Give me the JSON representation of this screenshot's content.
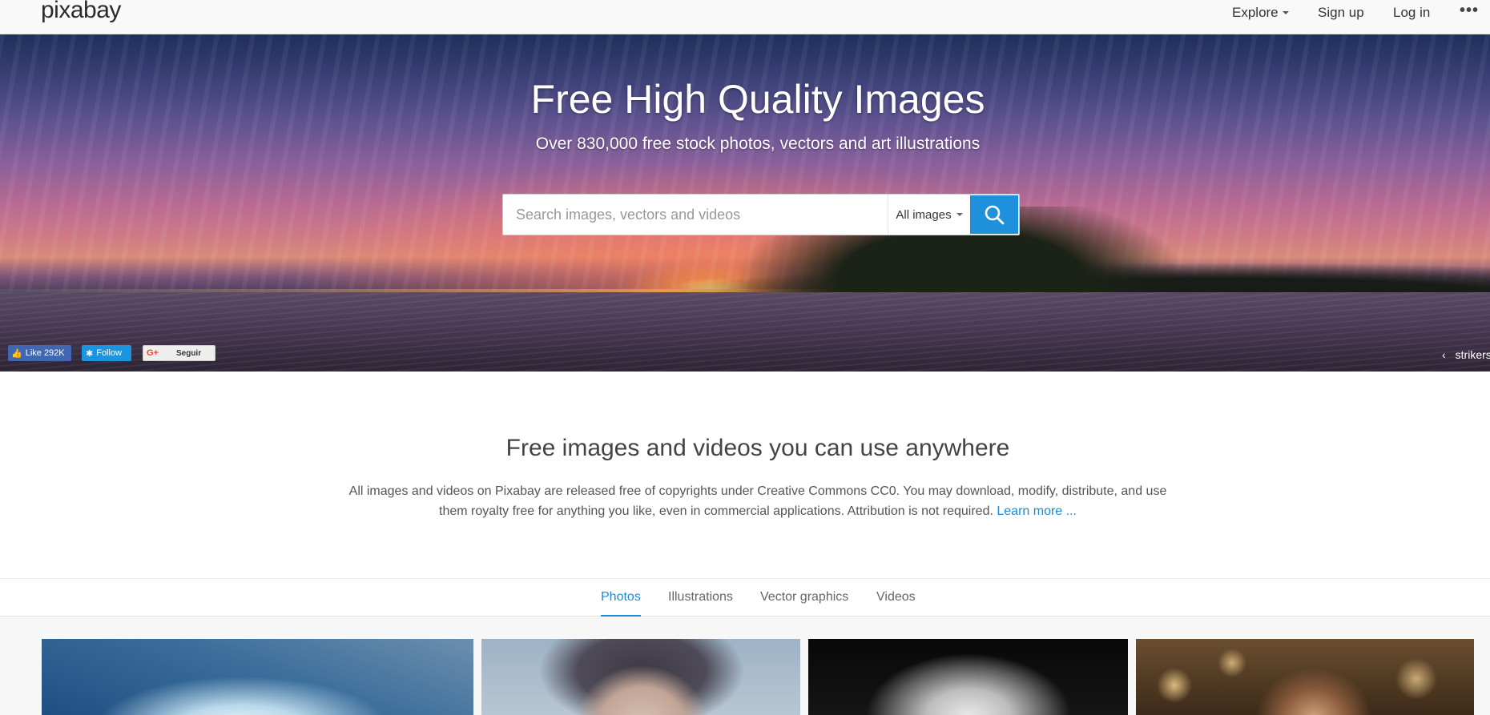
{
  "nav": {
    "logo": "pixabay",
    "explore": "Explore",
    "signup": "Sign up",
    "login": "Log in",
    "more": "•••"
  },
  "hero": {
    "title": "Free High Quality Images",
    "subtitle": "Over 830,000 free stock photos, vectors and art illustrations",
    "search": {
      "placeholder": "Search images, vectors and videos",
      "value": "",
      "type_selected": "All images"
    },
    "social": {
      "facebook_label": "Like 292K",
      "twitter_label": "Follow",
      "googleplus_icon_text": "G+",
      "googleplus_label": "Seguir"
    },
    "credit": "strikers"
  },
  "intro": {
    "title": "Free images and videos you can use anywhere",
    "text": "All images and videos on Pixabay are released free of copyrights under Creative Commons CC0. You may download, modify, distribute, and use them royalty free for anything you like, even in commercial applications. Attribution is not required.",
    "learn_more": "Learn more ..."
  },
  "tabs": [
    {
      "label": "Photos",
      "active": true
    },
    {
      "label": "Illustrations",
      "active": false
    },
    {
      "label": "Vector graphics",
      "active": false
    },
    {
      "label": "Videos",
      "active": false
    }
  ],
  "colors": {
    "accent": "#1e90dc",
    "link": "#1e8ad6",
    "facebook": "#4267b2",
    "twitter": "#1b95e0"
  }
}
